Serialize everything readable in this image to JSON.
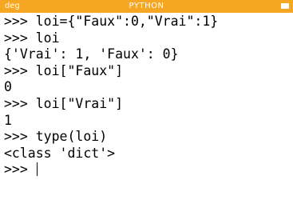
{
  "theme": {
    "accent": "#f5a623",
    "background": "#ffffff",
    "text": "#000000"
  },
  "titlebar": {
    "mode": "deg",
    "app": "PYTHON",
    "battery_icon": "battery-icon"
  },
  "console": {
    "lines": [
      ">>> loi={\"Faux\":0,\"Vrai\":1}",
      ">>> loi",
      "{'Vrai': 1, 'Faux': 0}",
      ">>> loi[\"Faux\"]",
      "0",
      ">>> loi[\"Vrai\"]",
      "1",
      ">>> type(loi)",
      "<class 'dict'>"
    ],
    "prompt": ">>> ",
    "input_value": ""
  }
}
